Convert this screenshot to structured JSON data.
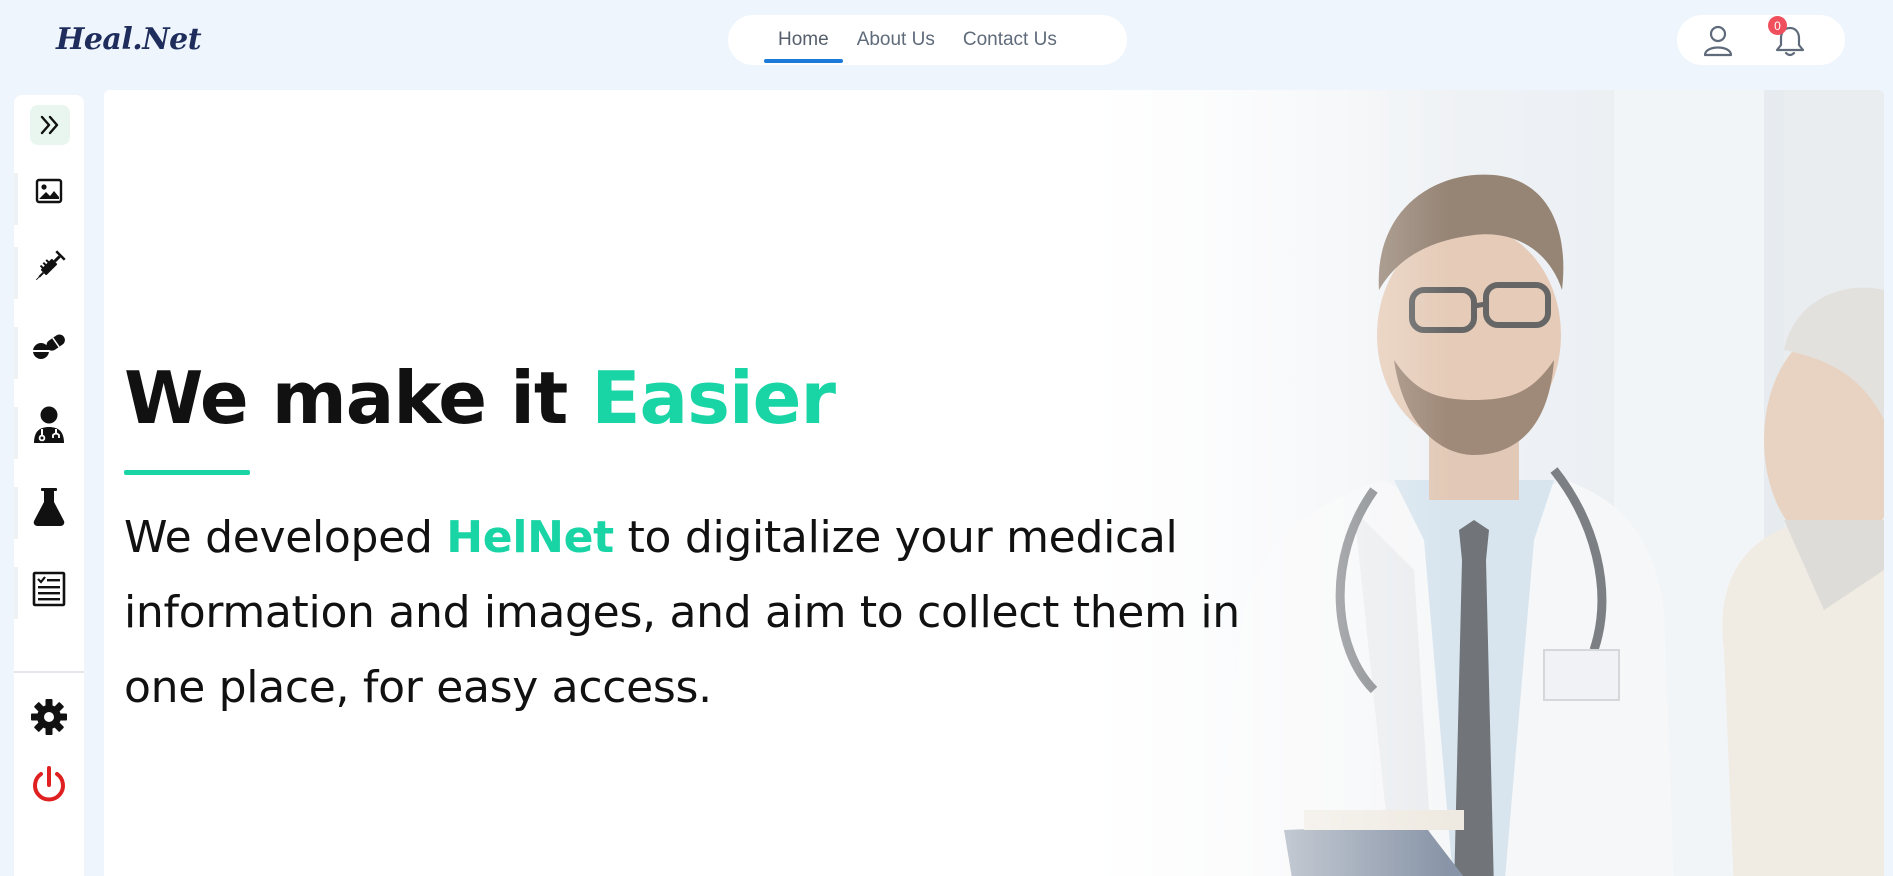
{
  "header": {
    "logo": "Heal.Net",
    "nav": [
      {
        "label": "Home",
        "active": true
      },
      {
        "label": "About Us",
        "active": false
      },
      {
        "label": "Contact Us",
        "active": false
      }
    ],
    "notification_count": "0"
  },
  "sidebar": {
    "items": [
      {
        "icon": "double-chevron-right-icon"
      },
      {
        "icon": "image-icon"
      },
      {
        "icon": "syringe-icon"
      },
      {
        "icon": "pills-icon"
      },
      {
        "icon": "doctor-icon"
      },
      {
        "icon": "flask-icon"
      },
      {
        "icon": "report-icon"
      },
      {
        "icon": "gear-icon"
      },
      {
        "icon": "power-icon"
      }
    ]
  },
  "hero": {
    "headline_main": "We make it ",
    "headline_accent": "Easier",
    "desc_before": "We developed ",
    "desc_brand": "HelNet",
    "desc_after": " to digitalize your medical information and images, and aim to collect them in one place, for easy access."
  },
  "colors": {
    "accent": "#19d5a6",
    "nav_active": "#1c7ad8",
    "badge": "#f0505d",
    "power": "#e02020"
  }
}
